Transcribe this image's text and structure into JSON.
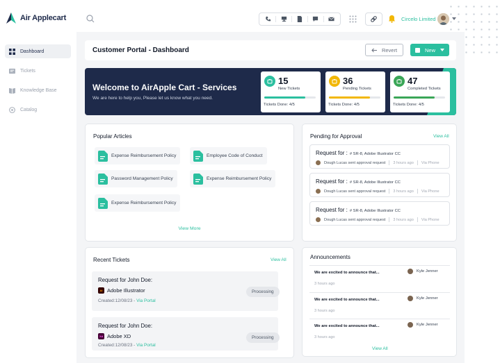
{
  "app": {
    "brand": "Air Applecart",
    "colors": {
      "accent": "#2bbf9f",
      "navy": "#1e2a4a",
      "amber": "#f2b705",
      "background": "#f4f5f7"
    }
  },
  "sidebar": {
    "items": [
      {
        "label": "Dashboard",
        "icon": "dashboard-icon",
        "active": true
      },
      {
        "label": "Tickets",
        "icon": "ticket-icon",
        "active": false
      },
      {
        "label": "Knowledge Base",
        "icon": "book-icon",
        "active": false
      },
      {
        "label": "Catalog",
        "icon": "catalog-icon",
        "active": false
      }
    ]
  },
  "topbar": {
    "icons": [
      "search-icon",
      "phone-icon",
      "desk-icon",
      "document-icon",
      "chat-icon",
      "mail-icon",
      "apps-grid-icon",
      "link-icon",
      "bell-icon"
    ],
    "org_name": "Circelo Limited"
  },
  "header": {
    "title": "Customer Portal - Dashboard",
    "revert_label": "Revert",
    "new_label": "New"
  },
  "banner": {
    "title": "Welcome to AirApple Cart - Services",
    "subtitle": "We are here to help you, Please let us know what you need.",
    "stats": [
      {
        "count": "15",
        "label": "New Tickets",
        "done": "Tickets Done: 4/5",
        "color": "#2bbf9f",
        "progress": 0.8
      },
      {
        "count": "36",
        "label": "Pending Tickets",
        "done": "Tickets Done: 4/5",
        "color": "#f2b705",
        "progress": 0.8
      },
      {
        "count": "47",
        "label": "Completed Tickets",
        "done": "Tickets Done: 4/5",
        "color": "#3aa657",
        "progress": 0.8
      }
    ]
  },
  "articles": {
    "title": "Popular Articles",
    "items": [
      "Expense Reimbursement Policy",
      "Employee Code of Conduct",
      "Password Management Policy",
      "Expense Reimbursement Policy",
      "Expense Reimbursement Policy"
    ],
    "view_more": "View More"
  },
  "approvals": {
    "title": "Pending for Approval",
    "view_all": "View All",
    "items": [
      {
        "title": "Request for :",
        "ref": "# SR-8, Adobe Illustrator CC",
        "user": "Dough Lucas sent approval request",
        "time": "3 hours ago",
        "via": "Via Phone"
      },
      {
        "title": "Request for :",
        "ref": "# SR-8, Adobe Illustrator CC",
        "user": "Dough Lucas sent approval request",
        "time": "3 hours ago",
        "via": "Via Phone"
      },
      {
        "title": "Request for :",
        "ref": "# SR-8, Adobe Illustrator CC",
        "user": "Dough Lucas sent approval request",
        "time": "3 hours ago",
        "via": "Via Phone"
      }
    ]
  },
  "tickets": {
    "title": "Recent Tickets",
    "view_all": "View All",
    "items": [
      {
        "title": "Request for John Doe:",
        "app": "Adobe Illustrator",
        "app_abbr": "Ai",
        "app_color": "#330000",
        "created": "Created:12/08/23 - ",
        "via": "Via Portal",
        "status": "Processing"
      },
      {
        "title": "Request for John Doe:",
        "app": "Adobe XD",
        "app_abbr": "Xd",
        "app_color": "#470137",
        "created": "Created:12/08/23 - ",
        "via": "Via Portal",
        "status": "Processing"
      }
    ]
  },
  "announcements": {
    "title": "Announcements",
    "view_all": "View All",
    "items": [
      {
        "text": "We are excited to announce that...",
        "user": "Kyle Jenner",
        "time": "3 hours ago"
      },
      {
        "text": "We are excited to announce that...",
        "user": "Kyle Jenner",
        "time": "3 hours ago"
      },
      {
        "text": "We are excited to announce that...",
        "user": "Kyle Jenner",
        "time": "3 hours ago"
      }
    ]
  }
}
